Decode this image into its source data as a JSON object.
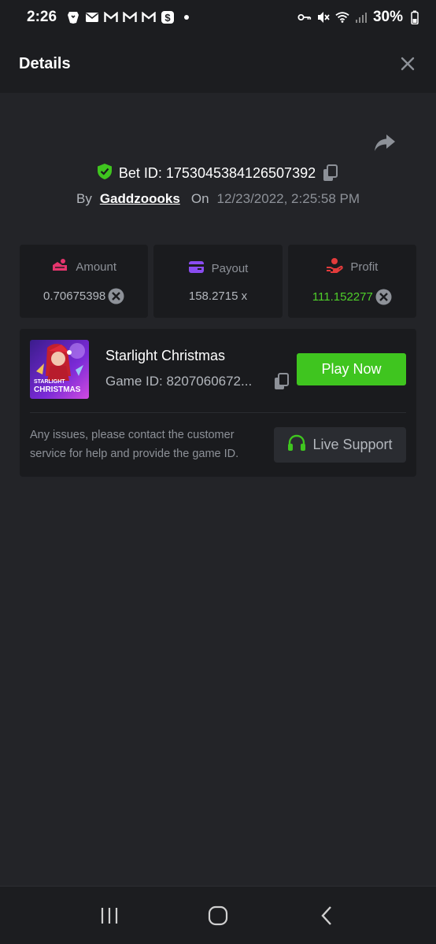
{
  "status_bar": {
    "time": "2:26",
    "battery": "30%",
    "left_icons": [
      "brave-icon",
      "mail-icon",
      "gmail-icon",
      "gmail-icon",
      "gmail-icon",
      "cash-app-icon",
      "dot-icon"
    ],
    "right_icons": [
      "key-icon",
      "mute-icon",
      "wifi-icon",
      "signal-icon",
      "battery-icon"
    ]
  },
  "header": {
    "title": "Details",
    "close_icon": "close-icon"
  },
  "bet": {
    "bet_id_text": "Bet ID: 1753045384126507392",
    "by_label": "By",
    "username": "Gaddzoooks",
    "on_label": "On",
    "datetime": "12/23/2022, 2:25:58 PM"
  },
  "stats": {
    "amount": {
      "label": "Amount",
      "value": "0.70675398",
      "icon": "amount-icon",
      "color": "#e5356d"
    },
    "payout": {
      "label": "Payout",
      "value": "158.2715 x",
      "icon": "wallet-icon",
      "color": "#8a4cf0"
    },
    "profit": {
      "label": "Profit",
      "value": "111.152277",
      "icon": "profit-icon",
      "color": "#e33b3b"
    }
  },
  "game": {
    "name": "Starlight Christmas",
    "game_id_text": "Game ID: 8207060672...",
    "thumb_text_1": "STARLIGHT",
    "thumb_text_2": "CHRISTMAS",
    "play_label": "Play Now",
    "help_text": "Any issues, please contact the customer service for help and provide the game ID.",
    "support_label": "Live Support"
  },
  "colors": {
    "accent_green": "#3fc51f",
    "profit_green": "#4fcf2a",
    "background": "#232428",
    "card": "#1a1b1e"
  },
  "nav": [
    "recent-apps-icon",
    "home-icon",
    "back-icon"
  ]
}
